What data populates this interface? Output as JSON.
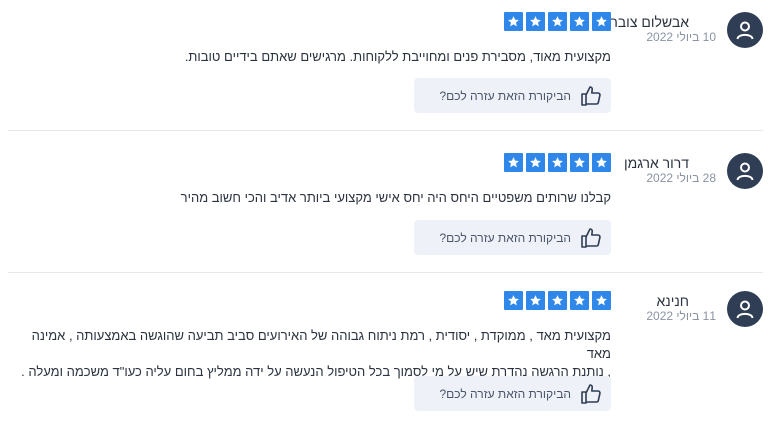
{
  "reviews": [
    {
      "name": "אבשלום צוברי",
      "date": "10 ביולי 2022",
      "rating": 5,
      "text": "מקצועית מאוד, מסבירת פנים ומחוייבת ללקוחות. מרגישים שאתם בידיים טובות.",
      "helpful_label": "הביקורת הזאת עזרה לכם?"
    },
    {
      "name": "דרור ארגמן",
      "date": "28 ביולי 2022",
      "rating": 5,
      "text": "קבלנו שרותים משפטיים היחס היה יחס אישי מקצועי ביותר אדיב והכי חשוב מהיר",
      "helpful_label": "הביקורת הזאת עזרה לכם?"
    },
    {
      "name": "חנינא",
      "date": "11 ביולי 2022",
      "rating": 5,
      "text_line1": "מקצועית מאד , ממוקדת , יסודית , רמת ניתוח גבוהה של האירועים סביב תביעה שהוגשה באמצעותה , אמינה מאד",
      "text_line2": ", נותנת הרגשה נהדרת שיש על מי לסמוך בכל הטיפול הנעשה על ידה ממליץ בחום עליה כעו\"ד משכמה ומעלה .",
      "helpful_label": "הביקורת הזאת עזרה לכם?"
    }
  ],
  "colors": {
    "star": "#2f87ea",
    "avatar": "#2f3d55",
    "button_bg": "#eef1f7"
  },
  "icons": {
    "avatar": "user-icon",
    "star": "star-icon",
    "helpful": "thumbs-up-icon"
  }
}
